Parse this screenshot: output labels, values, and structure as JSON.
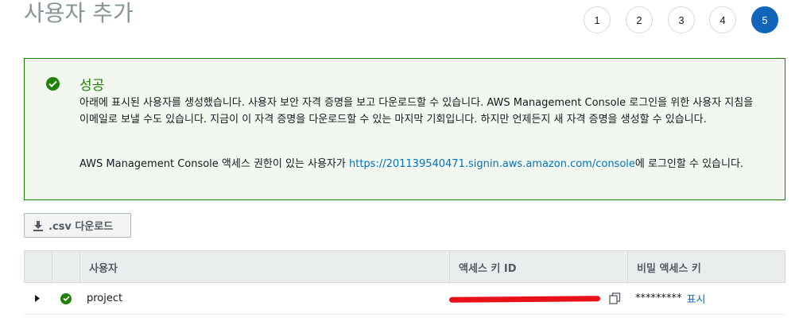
{
  "page": {
    "title": "사용자 추가"
  },
  "steps": [
    "1",
    "2",
    "3",
    "4",
    "5"
  ],
  "alert": {
    "title": "성공",
    "body": "아래에 표시된 사용자를 생성했습니다. 사용자 보안 자격 증명을 보고 다운로드할 수 있습니다. AWS Management Console 로그인을 위한 사용자 지침을 이메일로 보낼 수도 있습니다. 지금이 이 자격 증명을 다운로드할 수 있는 마지막 기회입니다. 하지만 언제든지 새 자격 증명을 생성할 수 있습니다.",
    "console_prefix": "AWS Management Console 액세스 권한이 있는 사용자가 ",
    "console_link": "https://201139540471.signin.aws.amazon.com/console",
    "console_suffix": "에 로그인할 수 있습니다."
  },
  "csv_button": {
    "label": ".csv 다운로드"
  },
  "table": {
    "headers": {
      "user": "사용자",
      "access_key": "액세스 키 ID",
      "secret_key": "비밀 액세스 키"
    },
    "rows": [
      {
        "user": "project",
        "secret_masked": "*********",
        "show_label": "표시"
      }
    ]
  },
  "colors": {
    "accent": "#1166bb",
    "success": "#1d8102",
    "link": "#0073bb"
  }
}
